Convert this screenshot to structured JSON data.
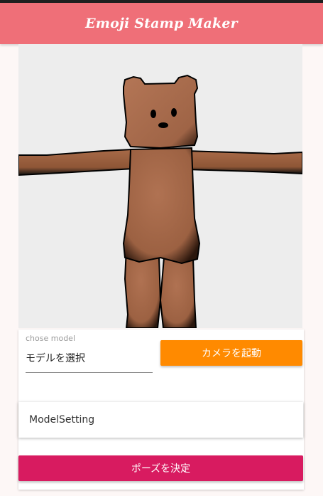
{
  "app": {
    "title": "Emoji Stamp Maker",
    "accent_color": "#ef6f78"
  },
  "viewport": {
    "content": "bear-3d-model",
    "background_color": "#ededed",
    "model_color": "#a86a48"
  },
  "model_select": {
    "label": "chose model",
    "placeholder": "モデルを選択"
  },
  "camera_button": {
    "label": "カメラを起動",
    "color": "#ff8a00"
  },
  "model_setting": {
    "label": "ModelSetting"
  },
  "pose_button": {
    "label": "ポーズを決定",
    "color": "#d81b60"
  }
}
